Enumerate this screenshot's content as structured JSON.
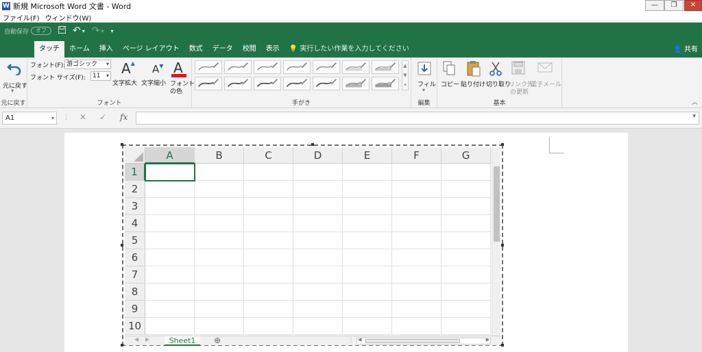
{
  "window": {
    "app_icon": "W",
    "title": "新規 Microsoft Word 文書 - Word",
    "minimize": "—",
    "restore": "❐",
    "close": "✕"
  },
  "menubar": {
    "items": [
      "ファイル(F)",
      "ウィンドウ(W)"
    ]
  },
  "qat": {
    "autosave_label": "自動保存",
    "autosave_toggle": "オフ",
    "save_icon": "💾",
    "undo_icon": "↶",
    "redo_icon": "↷",
    "customize_icon": "▾"
  },
  "tabs": {
    "items": [
      "タッチ",
      "ホーム",
      "挿入",
      "ページ レイアウト",
      "数式",
      "データ",
      "校閲",
      "表示"
    ],
    "search_text": "実行したい作業を入力してください",
    "share": "共有"
  },
  "ribbon": {
    "undo_group": {
      "button": "元に戻す",
      "label": "元に戻す"
    },
    "font_group": {
      "font_label": "フォント(F):",
      "font_value": "游ゴシック",
      "size_label": "フォント サイズ(F):",
      "size_value": "11",
      "grow": "文字拡大",
      "shrink": "文字縮小",
      "color": "フォントの色",
      "color_line1": "フォント",
      "color_line2": "の色",
      "label": "フォント",
      "font_color_hex": "#e81123"
    },
    "ink_group": {
      "label": "手がき"
    },
    "edit_group": {
      "fill": "フィル",
      "label": "編集"
    },
    "basic_group": {
      "copy": "コピー",
      "paste": "貼り付け",
      "cut": "切り取り",
      "update_link_1": "リンク先",
      "update_link_2": "の更新",
      "email": "電子メール",
      "label": "基本"
    }
  },
  "formula_bar": {
    "name_box": "A1",
    "cancel": "✕",
    "enter": "✓",
    "fx": "fx",
    "value": ""
  },
  "sheet": {
    "columns": [
      "A",
      "B",
      "C",
      "D",
      "E",
      "F",
      "G"
    ],
    "rows": [
      "1",
      "2",
      "3",
      "4",
      "5",
      "6",
      "7",
      "8",
      "9",
      "10"
    ],
    "active_cell": "A1",
    "tab_name": "Sheet1",
    "add_sheet": "⊕",
    "accent": "#217346"
  },
  "colors": {
    "ribbon_green": "#217346",
    "background": "#e6e6e6"
  }
}
